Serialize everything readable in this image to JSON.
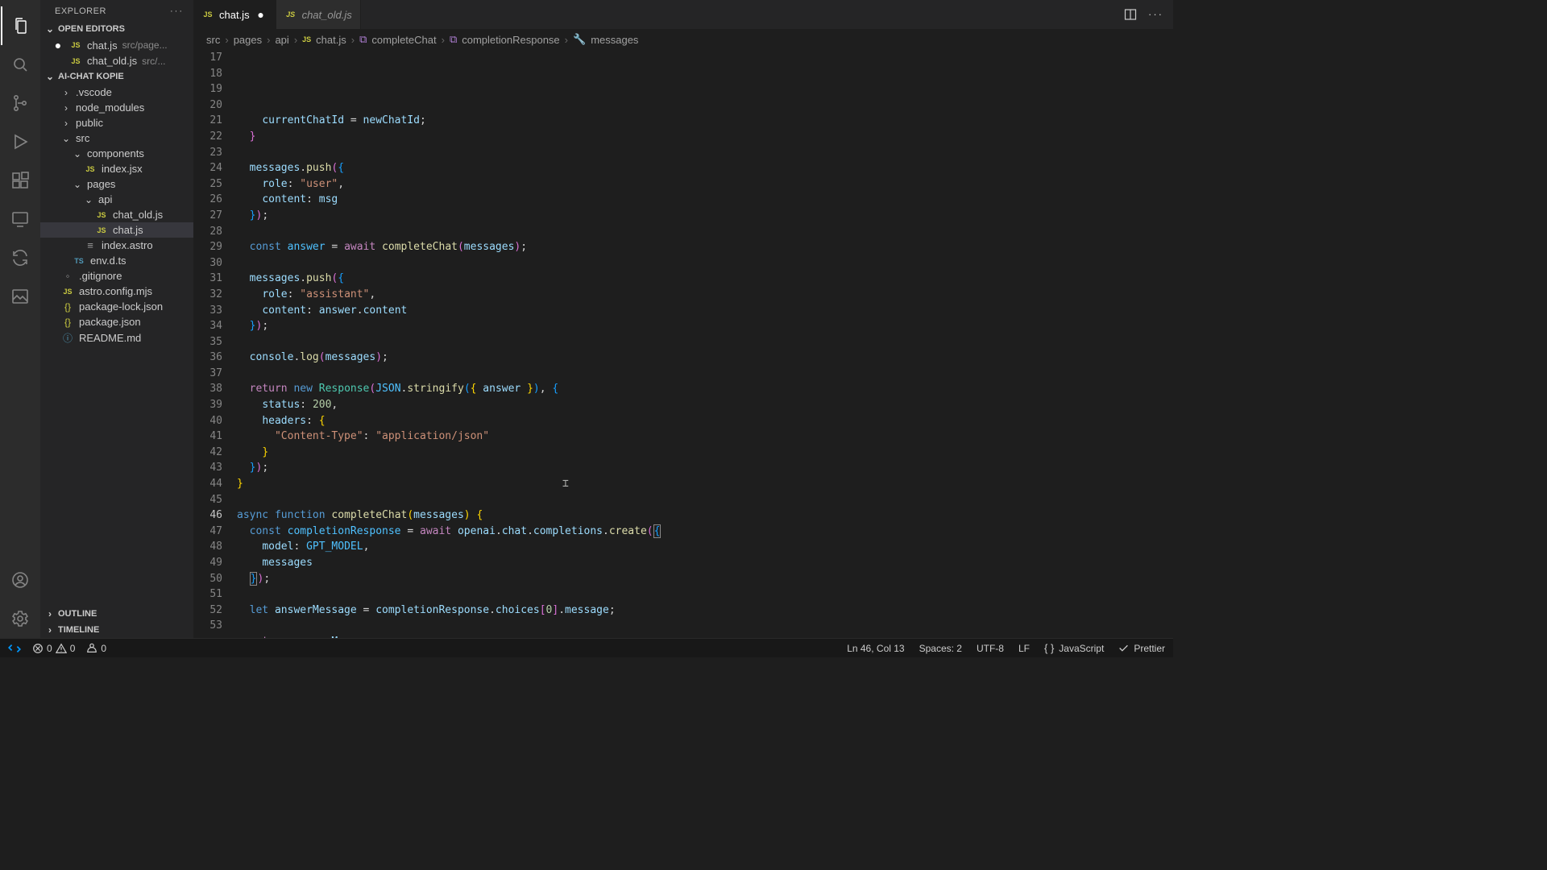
{
  "sidebar": {
    "title": "EXPLORER",
    "openEditors": {
      "label": "OPEN EDITORS",
      "items": [
        {
          "name": "chat.js",
          "path": "src/page...",
          "modified": true
        },
        {
          "name": "chat_old.js",
          "path": "src/..."
        }
      ]
    },
    "project": {
      "label": "AI-CHAT KOPIE",
      "tree": {
        "vscode": ".vscode",
        "node_modules": "node_modules",
        "public": "public",
        "src": "src",
        "components": "components",
        "indexjsx": "index.jsx",
        "pages": "pages",
        "api": "api",
        "chat_old": "chat_old.js",
        "chat": "chat.js",
        "indexastro": "index.astro",
        "envd": "env.d.ts",
        "gitignore": ".gitignore",
        "astroconfig": "astro.config.mjs",
        "pkglock": "package-lock.json",
        "pkg": "package.json",
        "readme": "README.md"
      }
    },
    "outline": "OUTLINE",
    "timeline": "TIMELINE"
  },
  "tabs": {
    "active": "chat.js",
    "inactive": "chat_old.js"
  },
  "breadcrumbs": {
    "p1": "src",
    "p2": "pages",
    "p3": "api",
    "p4": "chat.js",
    "p5": "completeChat",
    "p6": "completionResponse",
    "p7": "messages"
  },
  "editor": {
    "startLine": 17,
    "currentLine": 46
  },
  "status": {
    "remote": "",
    "errors": "0",
    "warnings": "0",
    "ports": "0",
    "lncol": "Ln 46, Col 13",
    "spaces": "Spaces: 2",
    "enc": "UTF-8",
    "eol": "LF",
    "lang": "JavaScript",
    "prettier": "Prettier"
  }
}
